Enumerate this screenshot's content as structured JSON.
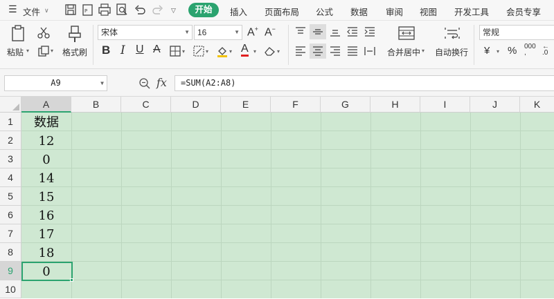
{
  "menu": {
    "file_label": "文件",
    "tabs": [
      "开始",
      "插入",
      "页面布局",
      "公式",
      "数据",
      "审阅",
      "视图",
      "开发工具",
      "会员专享"
    ]
  },
  "ribbon": {
    "paste_label": "粘贴",
    "format_painter_label": "格式刷",
    "font_name": "宋体",
    "font_size": "16",
    "merge_center_label": "合并居中",
    "wrap_text_label": "自动换行",
    "number_format": "常规",
    "currency_symbol": "¥",
    "percent_symbol": "%",
    "thousands_symbol": "000"
  },
  "formula_bar": {
    "cell_ref": "A9",
    "fx_label": "fx",
    "formula": "=SUM(A2:A8)"
  },
  "sheet": {
    "columns": [
      "A",
      "B",
      "C",
      "D",
      "E",
      "F",
      "G",
      "H",
      "I",
      "J",
      "K"
    ],
    "rows": [
      "1",
      "2",
      "3",
      "4",
      "5",
      "6",
      "7",
      "8",
      "9",
      "10"
    ],
    "column_a_values": [
      "数据",
      "12",
      "0",
      "14",
      "15",
      "16",
      "17",
      "18",
      "0",
      ""
    ],
    "selected_cell": "A9",
    "sheet_background": "#cfe8d2",
    "accent_color": "#2ba36f"
  }
}
